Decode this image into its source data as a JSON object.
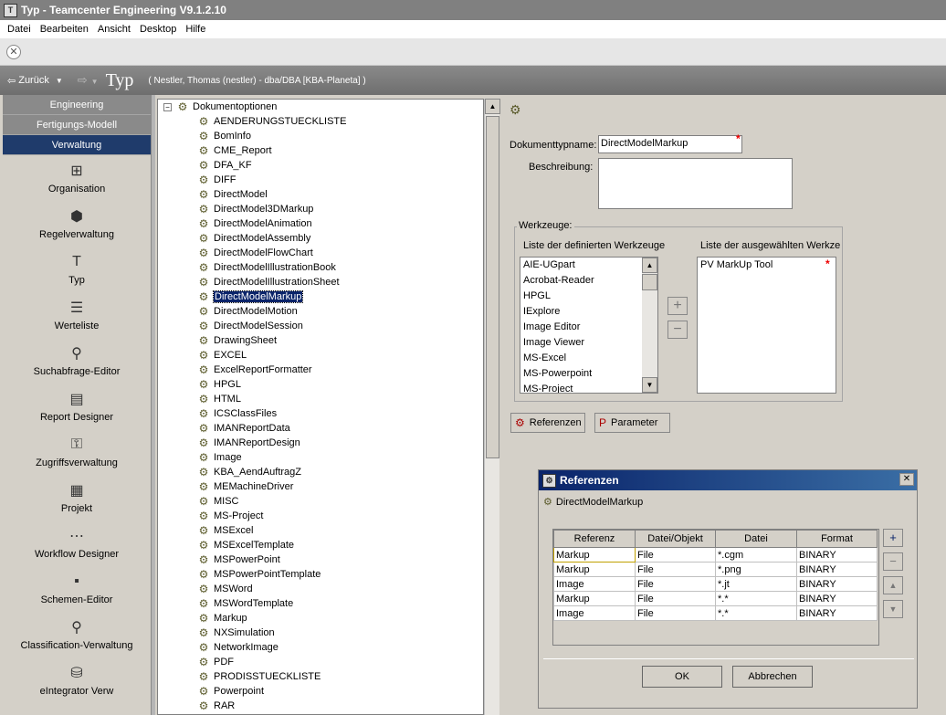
{
  "window": {
    "title": "Typ - Teamcenter Engineering V9.1.2.10"
  },
  "menu": [
    "Datei",
    "Bearbeiten",
    "Ansicht",
    "Desktop",
    "Hilfe"
  ],
  "nav": {
    "back_label": "Zurück",
    "title": "Typ",
    "user_info": "( Nestler, Thomas (nestler) - dba/DBA   [KBA-Planeta] )"
  },
  "left_panel": {
    "tabs": [
      "Engineering",
      "Fertigungs-Modell",
      "Verwaltung"
    ],
    "apps": [
      {
        "label": "Organisation",
        "icon": "organization-icon",
        "glyph": "⊞"
      },
      {
        "label": "Regelverwaltung",
        "icon": "cube-icon",
        "glyph": "⬢"
      },
      {
        "label": "Typ",
        "icon": "type-icon",
        "glyph": "T"
      },
      {
        "label": "Werteliste",
        "icon": "list-icon",
        "glyph": "☰"
      },
      {
        "label": "Suchabfrage-Editor",
        "icon": "search-editor-icon",
        "glyph": "⚲"
      },
      {
        "label": "Report Designer",
        "icon": "report-icon",
        "glyph": "▤"
      },
      {
        "label": "Zugriffsverwaltung",
        "icon": "key-icon",
        "glyph": "⚿"
      },
      {
        "label": "Projekt",
        "icon": "project-icon",
        "glyph": "▦"
      },
      {
        "label": "Workflow Designer",
        "icon": "workflow-icon",
        "glyph": "⋯"
      },
      {
        "label": "Schemen-Editor",
        "icon": "schema-icon",
        "glyph": "▪"
      },
      {
        "label": "Classification-Verwaltung",
        "icon": "magnifier-icon",
        "glyph": "⚲"
      },
      {
        "label": "eIntegrator Verw",
        "icon": "database-icon",
        "glyph": "⛁"
      }
    ]
  },
  "tree": {
    "root": "Dokumentoptionen",
    "selected": "DirectModelMarkup",
    "items": [
      "AENDERUNGSTUECKLISTE",
      "BomInfo",
      "CME_Report",
      "DFA_KF",
      "DIFF",
      "DirectModel",
      "DirectModel3DMarkup",
      "DirectModelAnimation",
      "DirectModelAssembly",
      "DirectModelFlowChart",
      "DirectModelIllustrationBook",
      "DirectModelIllustrationSheet",
      "DirectModelMarkup",
      "DirectModelMotion",
      "DirectModelSession",
      "DrawingSheet",
      "EXCEL",
      "ExcelReportFormatter",
      "HPGL",
      "HTML",
      "ICSClassFiles",
      "IMANReportData",
      "IMANReportDesign",
      "Image",
      "KBA_AendAuftragZ",
      "MEMachineDriver",
      "MISC",
      "MS-Project",
      "MSExcel",
      "MSExcelTemplate",
      "MSPowerPoint",
      "MSPowerPointTemplate",
      "MSWord",
      "MSWordTemplate",
      "Markup",
      "NXSimulation",
      "NetworkImage",
      "PDF",
      "PRODISSTUECKLISTE",
      "Powerpoint",
      "RAR"
    ]
  },
  "form": {
    "doc_type_label": "Dokumenttypname:",
    "doc_type_value": "DirectModelMarkup",
    "desc_label": "Beschreibung:",
    "desc_value": "",
    "tools_legend": "Werkzeuge:",
    "defined_tools_label": "Liste der definierten Werkzeuge",
    "selected_tools_label": "Liste der ausgewählten Werkze",
    "defined_tools": [
      "AIE-UGpart",
      "Acrobat-Reader",
      "HPGL",
      "IExplore",
      "Image Editor",
      "Image Viewer",
      "MS-Excel",
      "MS-Powerpoint",
      "MS-Project"
    ],
    "selected_tools": [
      "PV MarkUp Tool"
    ],
    "add_glyph": "+",
    "remove_glyph": "−",
    "references_button": "Referenzen",
    "parameters_button": "Parameter"
  },
  "dialog": {
    "title": "Referenzen",
    "close_glyph": "✕",
    "subject": "DirectModelMarkup",
    "columns": [
      "Referenz",
      "Datei/Objekt",
      "Datei",
      "Format"
    ],
    "rows": [
      [
        "Markup",
        "File",
        "*.cgm",
        "BINARY"
      ],
      [
        "Markup",
        "File",
        "*.png",
        "BINARY"
      ],
      [
        "Image",
        "File",
        "*.jt",
        "BINARY"
      ],
      [
        "Markup",
        "File",
        "*.*",
        "BINARY"
      ],
      [
        "Image",
        "File",
        "*.*",
        "BINARY"
      ]
    ],
    "ok_label": "OK",
    "cancel_label": "Abbrechen",
    "side_buttons": [
      "+",
      "−",
      "▲",
      "▼"
    ]
  }
}
